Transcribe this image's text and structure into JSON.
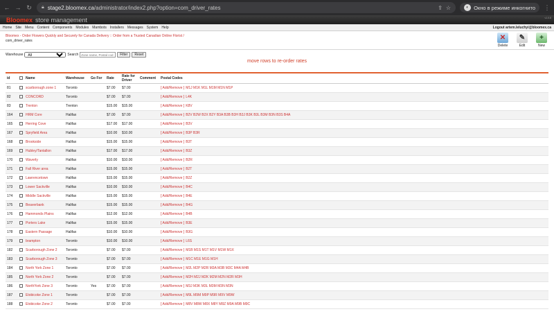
{
  "browser": {
    "url_host": "stage2.bloomex.ca",
    "url_path": "/administrator/index2.php?option=com_driver_rates",
    "incognito_label": "Окно в режиме инкогнито"
  },
  "brand": {
    "name": "Bloomex",
    "subtitle": "store management",
    "version": "v1.0.8"
  },
  "menu": {
    "items": [
      "Home",
      "Site",
      "Menu",
      "Content",
      "Components",
      "Modules",
      "Mambots",
      "Installers",
      "Messages",
      "System",
      "Help"
    ],
    "user": "Logout artem.leluchyi@bloomex.ca"
  },
  "breadcrumb": {
    "line1": "Bloomex - Order Flowers Quickly and Securely for Canada Delivery :: Order from a Trusted Canadian Online Florist /",
    "line2": "com_driver_rates"
  },
  "toolbar": {
    "delete": "Delete",
    "edit": "Edit",
    "new": "New"
  },
  "filters": {
    "warehouse_label": "Warehouse",
    "warehouse_value": "All",
    "search_label": "Search",
    "search_placeholder": "Zone name, Postal cod",
    "filter_button": "Filter",
    "reset_button": "Reset"
  },
  "hint": "move rows to re-order rates",
  "table": {
    "columns": [
      "id",
      "Name",
      "Warehouse",
      "Go For",
      "Rate",
      "Rate for Driver",
      "Comment",
      "Postal Codes"
    ],
    "rows": [
      {
        "id": "81",
        "name": "scarborough zone 1",
        "wh": "Toronto",
        "go": "",
        "rate": "$7.00",
        "driver": "$7.00",
        "zones": "M1J M1K M1L M1M M1N M1P"
      },
      {
        "id": "82",
        "name": "CONCORD",
        "wh": "Toronto",
        "go": "",
        "rate": "$7.00",
        "driver": "$7.00",
        "zones": "L4K"
      },
      {
        "id": "83",
        "name": "Trenton",
        "wh": "Trenton",
        "go": "",
        "rate": "$15.00",
        "driver": "$15.00",
        "zones": "K8V"
      },
      {
        "id": "164",
        "name": "HRM Core",
        "wh": "Halifax",
        "go": "",
        "rate": "$7.00",
        "driver": "$7.00",
        "zones": "B2V B2W B2X B2Y B3A B3B B3H B3J B3K B3L B3M B3N B3S B4A"
      },
      {
        "id": "165",
        "name": "Herring Cove",
        "wh": "Halifax",
        "go": "",
        "rate": "$17.00",
        "driver": "$17.00",
        "zones": "B3V"
      },
      {
        "id": "167",
        "name": "Spryfield Area",
        "wh": "Halifax",
        "go": "",
        "rate": "$10.00",
        "driver": "$10.00",
        "zones": "B3P B3R"
      },
      {
        "id": "168",
        "name": "Brookside",
        "wh": "Halifax",
        "go": "",
        "rate": "$15.00",
        "driver": "$15.00",
        "zones": "B3T"
      },
      {
        "id": "169",
        "name": "Hubley/Tantallon",
        "wh": "Halifax",
        "go": "",
        "rate": "$17.00",
        "driver": "$17.00",
        "zones": "B3Z"
      },
      {
        "id": "170",
        "name": "Waverly",
        "wh": "Halifax",
        "go": "",
        "rate": "$10.00",
        "driver": "$10.00",
        "zones": "B2R"
      },
      {
        "id": "171",
        "name": "Fall River area",
        "wh": "Halifax",
        "go": "",
        "rate": "$15.00",
        "driver": "$15.00",
        "zones": "B2T"
      },
      {
        "id": "172",
        "name": "Lawrencetown",
        "wh": "Halifax",
        "go": "",
        "rate": "$15.00",
        "driver": "$15.00",
        "zones": "B2Z"
      },
      {
        "id": "173",
        "name": "Lower Sackville",
        "wh": "Halifax",
        "go": "",
        "rate": "$10.00",
        "driver": "$10.00",
        "zones": "B4C"
      },
      {
        "id": "174",
        "name": "Middle Sackville",
        "wh": "Halifax",
        "go": "",
        "rate": "$15.00",
        "driver": "$15.00",
        "zones": "B4E"
      },
      {
        "id": "175",
        "name": "Beaverbank",
        "wh": "Halifax",
        "go": "",
        "rate": "$15.00",
        "driver": "$15.00",
        "zones": "B4G"
      },
      {
        "id": "176",
        "name": "Hammonds Plains",
        "wh": "Halifax",
        "go": "",
        "rate": "$12.00",
        "driver": "$12.00",
        "zones": "B4B"
      },
      {
        "id": "177",
        "name": "Porters Lake",
        "wh": "Halifax",
        "go": "",
        "rate": "$15.00",
        "driver": "$15.00",
        "zones": "B3E"
      },
      {
        "id": "178",
        "name": "Eastern Passage",
        "wh": "Halifax",
        "go": "",
        "rate": "$10.00",
        "driver": "$10.00",
        "zones": "B3G"
      },
      {
        "id": "179",
        "name": "brampton",
        "wh": "Toronto",
        "go": "",
        "rate": "$10.00",
        "driver": "$10.00",
        "zones": "L6S"
      },
      {
        "id": "182",
        "name": "Scarborough Zone 2",
        "wh": "Toronto",
        "go": "",
        "rate": "$7.00",
        "driver": "$7.00",
        "zones": "M1B M1S M1T M1V M1W M1X"
      },
      {
        "id": "183",
        "name": "Scarborough Zone 3",
        "wh": "Toronto",
        "go": "",
        "rate": "$7.00",
        "driver": "$7.00",
        "zones": "M1C M1E M1G M1H"
      },
      {
        "id": "184",
        "name": "North York Zone 1",
        "wh": "Toronto",
        "go": "",
        "rate": "$7.00",
        "driver": "$7.00",
        "zones": "M2L M2P M2R M3A M3B M3C M4A M4B"
      },
      {
        "id": "185",
        "name": "North York Zone 2",
        "wh": "Toronto",
        "go": "",
        "rate": "$7.00",
        "driver": "$7.00",
        "zones": "M2H M2J M2K M2M M2N M2R M3H"
      },
      {
        "id": "186",
        "name": "NorthYork Zone 3",
        "wh": "Toronto",
        "go": "Yes",
        "rate": "$7.00",
        "driver": "$7.00",
        "zones": "M3J M3K M3L M3M M3N M3N"
      },
      {
        "id": "187",
        "name": "Etobicoke Zone 1",
        "wh": "Toronto",
        "go": "",
        "rate": "$7.00",
        "driver": "$7.00",
        "zones": "M9L M9M M9P M9R M9V M9W"
      },
      {
        "id": "188",
        "name": "Etobicoke Zone 2",
        "wh": "Toronto",
        "go": "",
        "rate": "$7.00",
        "driver": "$7.00",
        "zones": "M8V M8W M8X M8Y M8Z M9A M9B M9C"
      }
    ],
    "action_label": "[ Add/Remove ]"
  }
}
